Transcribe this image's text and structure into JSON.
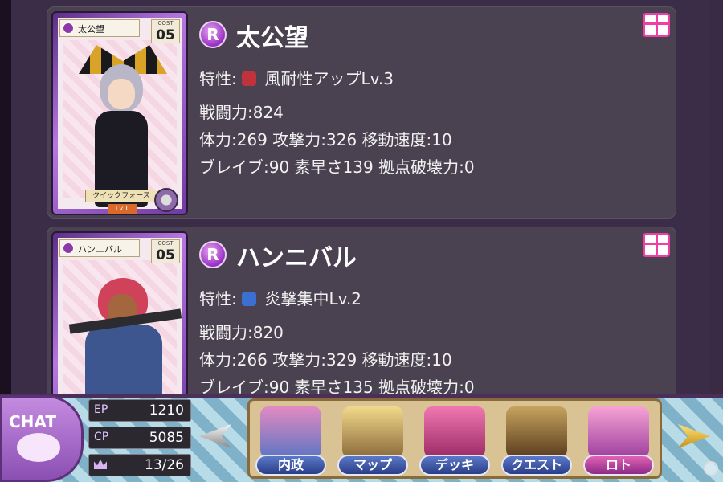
{
  "units": [
    {
      "card_name": "太公望",
      "cost_label": "COST",
      "cost": "05",
      "skill": "クイックフォース",
      "skill_level": "Lv.1",
      "rarity": "R",
      "name": "太公望",
      "trait_prefix": "特性:",
      "trait": "風耐性アップLv.3",
      "trait_icon_color": "#c0333d",
      "power": "戦闘力:824",
      "line2": "体力:269 攻撃力:326 移動速度:10",
      "line3": "ブレイブ:90 素早さ139 拠点破壊力:0"
    },
    {
      "card_name": "ハンニバル",
      "cost_label": "COST",
      "cost": "05",
      "rarity": "R",
      "name": "ハンニバル",
      "trait_prefix": "特性:",
      "trait": "炎撃集中Lv.2",
      "trait_icon_color": "#3b6fd1",
      "power": "戦闘力:820",
      "line2": "体力:266 攻撃力:329 移動速度:10",
      "line3": "ブレイブ:90 素早さ135 拠点破壊力:0"
    }
  ],
  "hud": {
    "chat_label": "CHAT",
    "ep_label": "EP",
    "ep_value": "1210",
    "cp_label": "CP",
    "cp_value": "5085",
    "rank_value": "13/26",
    "menu": [
      {
        "label": "内政"
      },
      {
        "label": "マップ"
      },
      {
        "label": "デッキ"
      },
      {
        "label": "クエスト"
      },
      {
        "label": "ロト"
      }
    ]
  },
  "colors": {
    "accent_purple": "#9a2fc4",
    "gift_pink": "#ee3fa4"
  }
}
